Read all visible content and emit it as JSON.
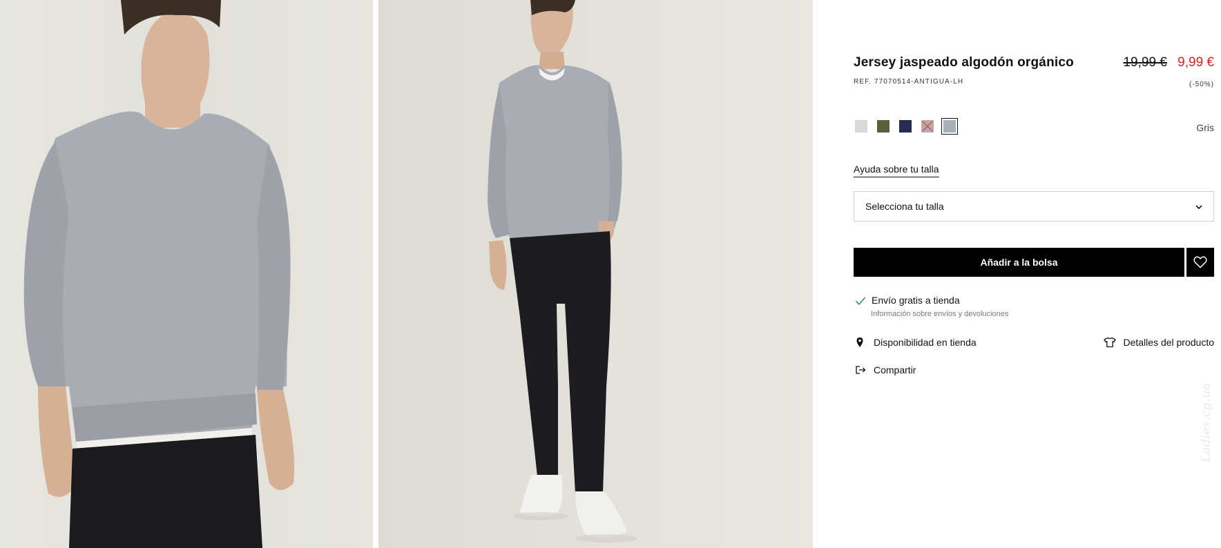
{
  "gallery": {
    "images": [
      {
        "alt": "Model wearing grey marl crew-neck sweater, close-up"
      },
      {
        "alt": "Model wearing grey marl sweater with black jeans and white sneakers, full body"
      }
    ]
  },
  "product": {
    "title": "Jersey jaspeado algodón orgánico",
    "ref": "REF. 77070514-ANTIGUA-LH",
    "price_old": "19,99 €",
    "price_new": "9,99 €",
    "discount": "(-50%)",
    "colors": {
      "selected_name": "Gris",
      "swatches": [
        {
          "name": "light-grey",
          "hex": "#d9d9d9",
          "selected": false,
          "unavailable": false
        },
        {
          "name": "khaki",
          "hex": "#5c5f3b",
          "selected": false,
          "unavailable": false
        },
        {
          "name": "navy",
          "hex": "#232d52",
          "selected": false,
          "unavailable": false
        },
        {
          "name": "pink",
          "hex": "#c9a3a6",
          "selected": false,
          "unavailable": true
        },
        {
          "name": "grey",
          "hex": "#aab1bb",
          "selected": true,
          "unavailable": false
        }
      ]
    },
    "size_help": "Ayuda sobre tu talla",
    "size_select_placeholder": "Selecciona tu talla",
    "add_to_bag": "Añadir a la bolsa",
    "shipping": {
      "title": "Envío gratis a tienda",
      "info_link": "Información sobre envíos y devoluciones"
    },
    "store_availability": "Disponibilidad en tienda",
    "product_details": "Detalles del producto",
    "share": "Compartir"
  },
  "accent": {
    "price_sale": "#e02020",
    "button_bg": "#000000"
  },
  "icons": [
    "check-icon",
    "chevron-down-icon",
    "heart-icon",
    "map-pin-icon",
    "tshirt-icon",
    "share-icon"
  ],
  "watermark": "Ladies.cg.ua"
}
